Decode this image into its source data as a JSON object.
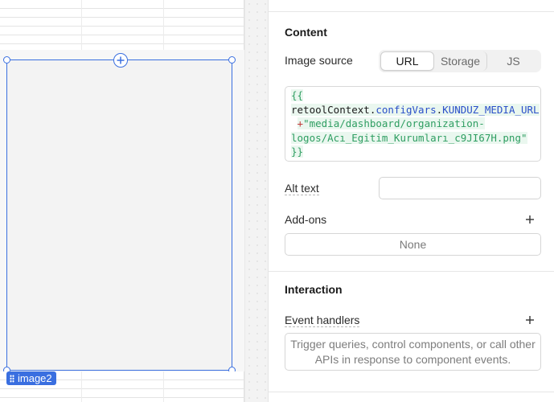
{
  "canvas": {
    "component_tag": "image2"
  },
  "inspector": {
    "content": {
      "title": "Content",
      "image_source": {
        "label": "Image source",
        "options": [
          "URL",
          "Storage",
          "JS"
        ],
        "selected": "URL"
      },
      "code": {
        "line1_open": "{{",
        "line2_ident": "retoolContext",
        "line2_dot1": ".",
        "line2_prop1": "configVars",
        "line2_dot2": ".",
        "line2_prop2": "KUNDUZ_MEDIA_URL",
        "line3_op": "+",
        "line3_str": "\"media/dashboard/organization-",
        "line4_str": "logos/Acı_Egitim_Kurumları_c9JI67H.png\"",
        "line5_close": "}}"
      },
      "alt_text": {
        "label": "Alt text",
        "value": ""
      },
      "addons": {
        "label": "Add-ons",
        "value": "None"
      }
    },
    "interaction": {
      "title": "Interaction",
      "event_handlers": {
        "label": "Event handlers",
        "empty_text": "Trigger queries, control components, or call other APIs in response to component events."
      }
    }
  },
  "colors": {
    "selection": "#3a6fe0",
    "code_green": "#2f9e62",
    "code_blue": "#2a4fc9",
    "code_red": "#c03a3a"
  },
  "icons": [
    "plus-circle-icon",
    "drag-handle-icon",
    "plus-icon"
  ]
}
